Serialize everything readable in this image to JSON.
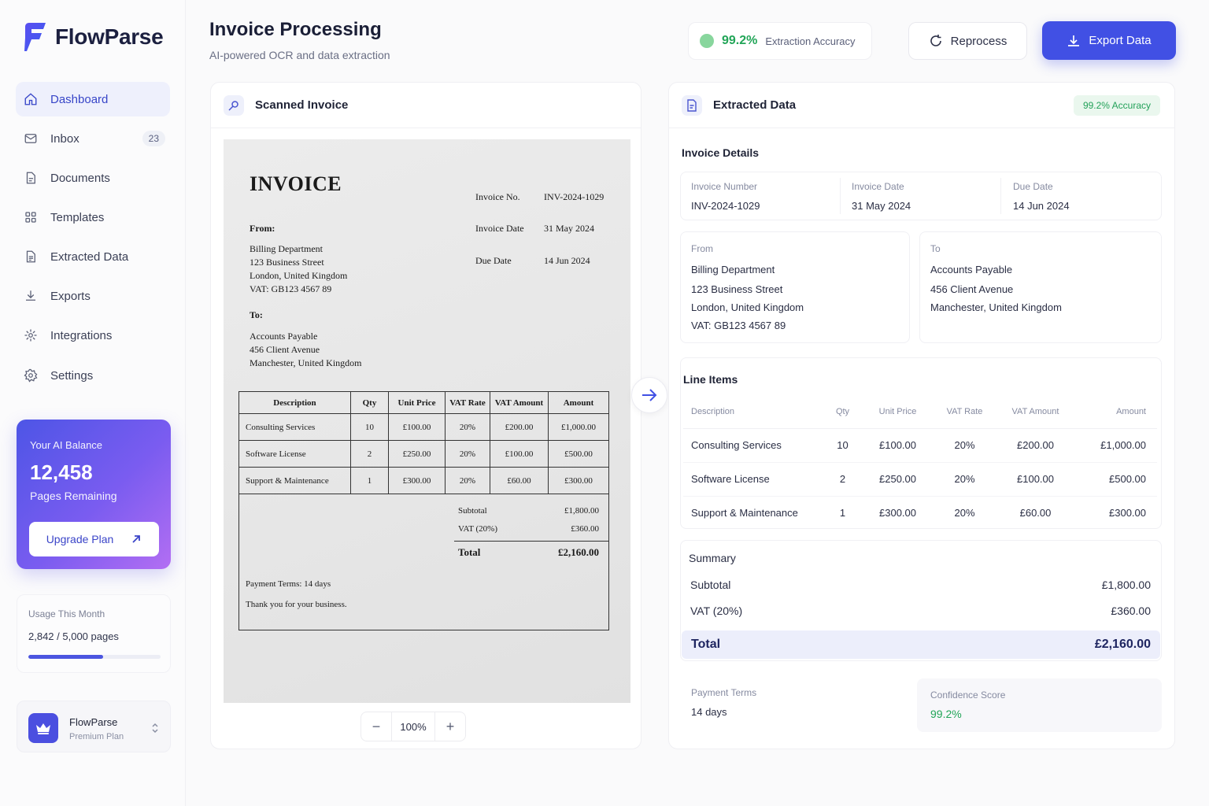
{
  "brand": {
    "name": "FlowParse"
  },
  "sidebar": {
    "items": [
      {
        "label": "Dashboard",
        "icon": "home-icon"
      },
      {
        "label": "Inbox",
        "icon": "inbox-icon",
        "badge": "23"
      },
      {
        "label": "Documents",
        "icon": "document-icon"
      },
      {
        "label": "Templates",
        "icon": "grid-icon"
      },
      {
        "label": "Extracted Data",
        "icon": "file-data-icon"
      },
      {
        "label": "Exports",
        "icon": "download-icon"
      },
      {
        "label": "Integrations",
        "icon": "integrations-icon"
      },
      {
        "label": "Settings",
        "icon": "gear-icon"
      }
    ],
    "balance": {
      "label": "Your AI Balance",
      "value": "12,458",
      "sub": "Pages Remaining",
      "button": "Upgrade Plan"
    },
    "usage": {
      "label": "Usage This Month",
      "value": "2,842 / 5,000 pages",
      "fraction": 0.5684
    },
    "account": {
      "name": "FlowParse",
      "plan": "Premium Plan"
    }
  },
  "header": {
    "title": "Invoice Processing",
    "subtitle": "AI-powered OCR and data extraction",
    "accuracy_value": "99.2%",
    "accuracy_label": "Extraction Accuracy",
    "reprocess": "Reprocess",
    "export": "Export Data"
  },
  "scanned": {
    "panel_title": "Scanned Invoice",
    "doc": {
      "heading": "INVOICE",
      "invoice_no_label": "Invoice No.",
      "invoice_no": "INV-2024-1029",
      "invoice_date_label": "Invoice Date",
      "invoice_date": "31 May 2024",
      "due_date_label": "Due Date",
      "due_date": "14 Jun 2024",
      "from_label": "From:",
      "from": [
        "Billing Department",
        "123 Business Street",
        "London, United Kingdom",
        "VAT: GB123 4567 89"
      ],
      "to_label": "To:",
      "to": [
        "Accounts Payable",
        "456 Client Avenue",
        "Manchester, United Kingdom"
      ],
      "headers": [
        "Description",
        "Qty",
        "Unit Price",
        "VAT Rate",
        "VAT Amount",
        "Amount"
      ],
      "rows": [
        [
          "Consulting Services",
          "10",
          "£100.00",
          "20%",
          "£200.00",
          "£1,000.00"
        ],
        [
          "Software License",
          "2",
          "£250.00",
          "20%",
          "£100.00",
          "£500.00"
        ],
        [
          "Support & Maintenance",
          "1",
          "£300.00",
          "20%",
          "£60.00",
          "£300.00"
        ]
      ],
      "subtotal_label": "Subtotal",
      "subtotal": "£1,800.00",
      "vat_label": "VAT (20%)",
      "vat": "£360.00",
      "total_label": "Total",
      "total": "£2,160.00",
      "terms": "Payment Terms: 14 days",
      "thanks": "Thank you for your business."
    },
    "zoom": "100%"
  },
  "extracted": {
    "panel_title": "Extracted Data",
    "accuracy_badge": "99.2% Accuracy",
    "details_title": "Invoice Details",
    "invoice_number_label": "Invoice Number",
    "invoice_number": "INV-2024-1029",
    "invoice_date_label": "Invoice Date",
    "invoice_date": "31 May 2024",
    "due_date_label": "Due Date",
    "due_date": "14 Jun 2024",
    "from_label": "From",
    "from": [
      "Billing Department",
      "123 Business Street",
      "London, United Kingdom",
      "VAT: GB123 4567 89"
    ],
    "to_label": "To",
    "to": [
      "Accounts Payable",
      "456 Client Avenue",
      "Manchester, United Kingdom"
    ],
    "line_items_title": "Line Items",
    "headers": [
      "Description",
      "Qty",
      "Unit Price",
      "VAT Rate",
      "VAT Amount",
      "Amount"
    ],
    "rows": [
      [
        "Consulting Services",
        "10",
        "£100.00",
        "20%",
        "£200.00",
        "£1,000.00"
      ],
      [
        "Software License",
        "2",
        "£250.00",
        "20%",
        "£100.00",
        "£500.00"
      ],
      [
        "Support & Maintenance",
        "1",
        "£300.00",
        "20%",
        "£60.00",
        "£300.00"
      ]
    ],
    "summary_title": "Summary",
    "subtotal_label": "Subtotal",
    "subtotal": "£1,800.00",
    "vat_label": "VAT (20%)",
    "vat": "£360.00",
    "total_label": "Total",
    "total": "£2,160.00",
    "terms_label": "Payment Terms",
    "terms": "14 days",
    "confidence_label": "Confidence Score",
    "confidence": "99.2%"
  },
  "colors": {
    "accent": "#4150e4",
    "success": "#22a558",
    "active_bg": "#eef0fc"
  }
}
